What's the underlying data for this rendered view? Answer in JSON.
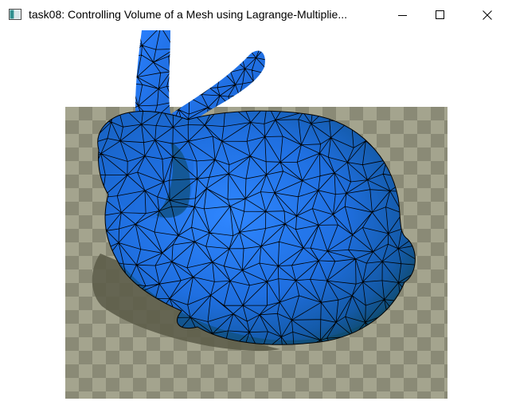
{
  "window": {
    "title": "task08: Controlling Volume of a Mesh using Lagrange-Multiplie...",
    "app_icon": "window-app-icon",
    "controls": {
      "minimize_icon": "minimize-icon",
      "maximize_icon": "maximize-icon",
      "close_icon": "close-icon"
    }
  },
  "scene": {
    "mesh": "bunny",
    "mesh_color": "#1f6fe0",
    "edge_color": "#000000",
    "floor_colors": [
      "#8a8a76",
      "#a4a48e"
    ],
    "shadow_color": "#5a5a48"
  }
}
